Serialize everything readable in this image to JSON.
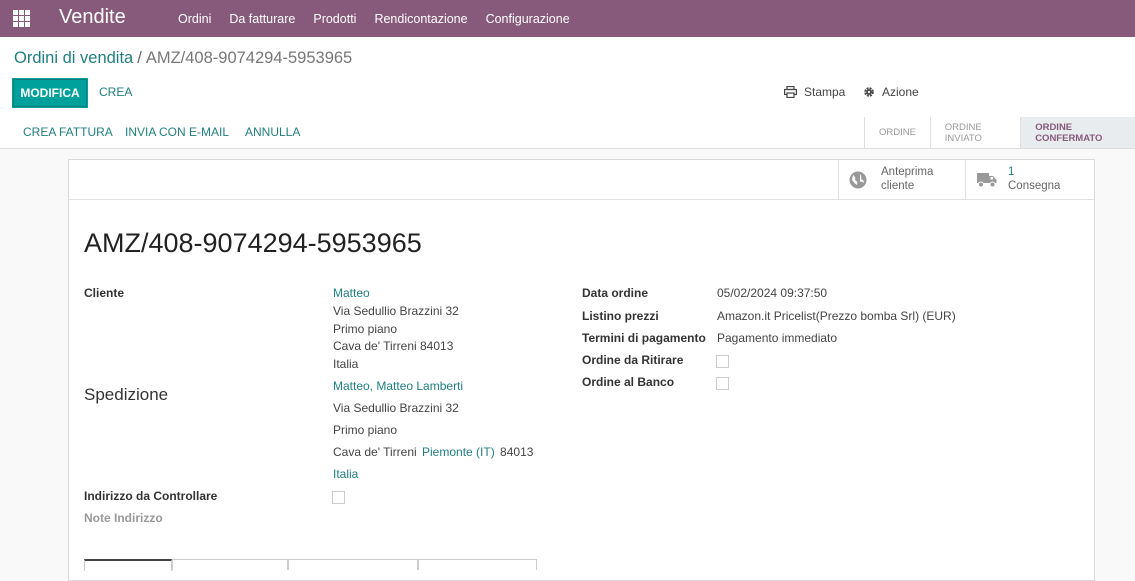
{
  "navbar": {
    "app_name": "Vendite",
    "menu": [
      "Ordini",
      "Da fatturare",
      "Prodotti",
      "Rendicontazione",
      "Configurazione"
    ]
  },
  "breadcrumb": {
    "parent": "Ordini di vendita",
    "separator": "/",
    "current": "AMZ/408-9074294-5953965"
  },
  "toolbar": {
    "edit_label": "MODIFICA",
    "create_label": "CREA",
    "print_label": "Stampa",
    "action_label": "Azione"
  },
  "statusbar": {
    "buttons": [
      "CREA FATTURA",
      "INVIA CON E-MAIL",
      "ANNULLA"
    ],
    "stages": [
      "ORDINE",
      "ORDINE INVIATO",
      "ORDINE CONFERMATO"
    ],
    "active_stage": "ORDINE CONFERMATO"
  },
  "smart_buttons": {
    "preview": {
      "line1": "Anteprima",
      "line2": "cliente",
      "icon": "globe-icon"
    },
    "delivery": {
      "count": "1",
      "label": "Consegna",
      "icon": "truck-icon"
    }
  },
  "order": {
    "title": "AMZ/408-9074294-5953965",
    "customer_label": "Cliente",
    "customer": {
      "name": "Matteo",
      "street": "Via Sedullio Brazzini 32",
      "street2": "Primo piano",
      "city_zip": "Cava de' Tirreni 84013",
      "country": "Italia"
    },
    "shipping_label": "Spedizione",
    "shipping": {
      "name": "Matteo, Matteo Lamberti",
      "street": "Via Sedullio Brazzini 32",
      "street2": "Primo piano",
      "city": "Cava de' Tirreni",
      "state": "Piemonte (IT)",
      "zip": "84013",
      "country": "Italia"
    },
    "address_check_label": "Indirizzo da Controllare",
    "address_check": false,
    "address_notes_label": "Note Indirizzo",
    "date_label": "Data ordine",
    "date": "05/02/2024 09:37:50",
    "pricelist_label": "Listino prezzi",
    "pricelist": "Amazon.it Pricelist(Prezzo bomba Srl) (EUR)",
    "payment_terms_label": "Termini di pagamento",
    "payment_terms": "Pagamento immediato",
    "pickup_label": "Ordine da Ritirare",
    "pickup": false,
    "counter_label": "Ordine al Banco",
    "counter": false
  },
  "colors": {
    "navbar": "#875a7b",
    "primary": "#00a09d",
    "link": "#1f7f80"
  }
}
